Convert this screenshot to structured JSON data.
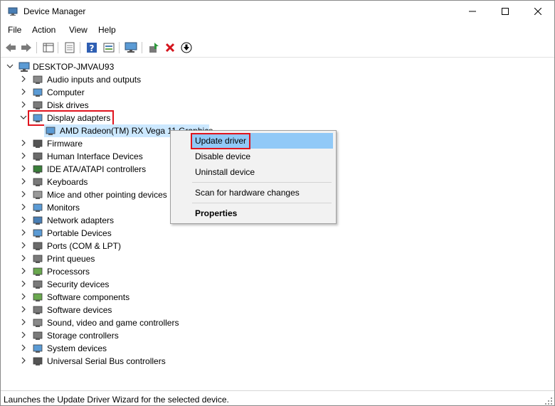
{
  "window": {
    "title": "Device Manager"
  },
  "menu": {
    "file": "File",
    "action": "Action",
    "view": "View",
    "help": "Help"
  },
  "toolbar": {
    "buttons": [
      "back-icon",
      "forward-icon",
      "show-hide-tree-icon",
      "properties-icon",
      "help-icon",
      "run-icon",
      "monitor-icon",
      "update-driver-icon",
      "uninstall-icon",
      "download-icon"
    ]
  },
  "tree": {
    "root": "DESKTOP-JMVAU93",
    "items": [
      {
        "label": "Audio inputs and outputs",
        "icon": "speaker-icon"
      },
      {
        "label": "Computer",
        "icon": "computer-icon"
      },
      {
        "label": "Disk drives",
        "icon": "disk-drive-icon"
      },
      {
        "label": "Display adapters",
        "icon": "display-adapter-icon",
        "expanded": true
      },
      {
        "label": "AMD Radeon(TM) RX Vega 11 Graphics",
        "icon": "display-adapter-icon",
        "child": true,
        "selected": true
      },
      {
        "label": "Firmware",
        "icon": "firmware-icon"
      },
      {
        "label": "Human Interface Devices",
        "icon": "hid-icon"
      },
      {
        "label": "IDE ATA/ATAPI controllers",
        "icon": "ide-controller-icon"
      },
      {
        "label": "Keyboards",
        "icon": "keyboard-icon"
      },
      {
        "label": "Mice and other pointing devices",
        "icon": "mouse-icon"
      },
      {
        "label": "Monitors",
        "icon": "monitor-icon"
      },
      {
        "label": "Network adapters",
        "icon": "network-adapter-icon"
      },
      {
        "label": "Portable Devices",
        "icon": "portable-device-icon"
      },
      {
        "label": "Ports (COM & LPT)",
        "icon": "port-icon"
      },
      {
        "label": "Print queues",
        "icon": "printer-icon"
      },
      {
        "label": "Processors",
        "icon": "processor-icon"
      },
      {
        "label": "Security devices",
        "icon": "security-device-icon"
      },
      {
        "label": "Software components",
        "icon": "software-component-icon"
      },
      {
        "label": "Software devices",
        "icon": "software-device-icon"
      },
      {
        "label": "Sound, video and game controllers",
        "icon": "sound-controller-icon"
      },
      {
        "label": "Storage controllers",
        "icon": "storage-controller-icon"
      },
      {
        "label": "System devices",
        "icon": "system-device-icon"
      },
      {
        "label": "Universal Serial Bus controllers",
        "icon": "usb-icon"
      }
    ]
  },
  "context_menu": {
    "update_driver": "Update driver",
    "disable_device": "Disable device",
    "uninstall_device": "Uninstall device",
    "scan_hardware": "Scan for hardware changes",
    "properties": "Properties"
  },
  "status": {
    "text": "Launches the Update Driver Wizard for the selected device."
  },
  "colors": {
    "selection": "#cce8ff",
    "menu_highlight": "#91c9f7",
    "annotation_red": "#e0141e"
  }
}
